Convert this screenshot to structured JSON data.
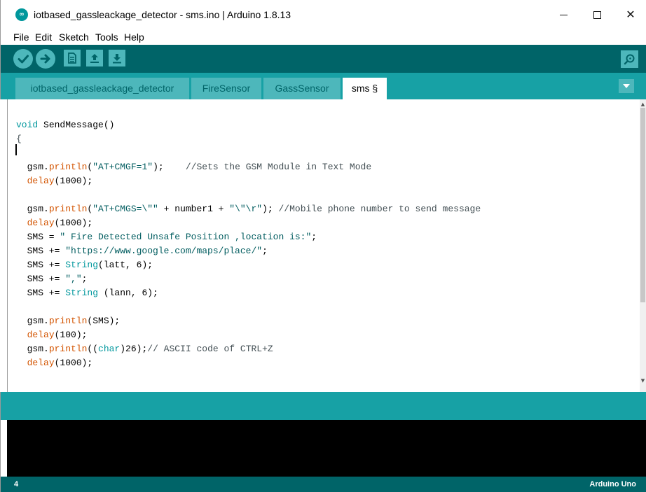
{
  "window": {
    "title": "iotbased_gassleackage_detector - sms.ino | Arduino 1.8.13",
    "logo_text": "∞",
    "minimize_icon": "minimize-icon",
    "maximize_icon": "maximize-icon",
    "close_glyph": "✕"
  },
  "menu": {
    "items": [
      "File",
      "Edit",
      "Sketch",
      "Tools",
      "Help"
    ]
  },
  "toolbar": {
    "buttons": [
      "verify-icon",
      "upload-icon",
      "new-icon",
      "open-icon",
      "save-icon"
    ],
    "serial_monitor": "serial-monitor-icon",
    "accent": "#4db7bb",
    "background": "#006468"
  },
  "tabs": [
    {
      "label": "iotbased_gassleackage_detector",
      "active": false
    },
    {
      "label": "FireSensor",
      "active": false
    },
    {
      "label": "GassSensor",
      "active": false
    },
    {
      "label": "sms §",
      "active": true
    }
  ],
  "editor": {
    "lines": [
      "void SendMessage()",
      "{",
      "",
      "  gsm.println(\"AT+CMGF=1\");    //Sets the GSM Module in Text Mode",
      "  delay(1000);",
      "",
      "  gsm.println(\"AT+CMGS=\\\"\" + number1 + \"\\\"\\r\"); //Mobile phone number to send message",
      "  delay(1000);",
      "  SMS = \" Fire Detected Unsafe Position ,location is:\";",
      "  SMS += \"https://www.google.com/maps/place/\";",
      "  SMS += String(latt, 6);",
      "  SMS += \",\";",
      "  SMS += String (lann, 6);",
      "",
      "  gsm.println(SMS);",
      "  delay(100);",
      "  gsm.println((char)26);// ASCII code of CTRL+Z",
      "  delay(1000);"
    ]
  },
  "status": {
    "line_number": "4",
    "board": "Arduino Uno"
  }
}
